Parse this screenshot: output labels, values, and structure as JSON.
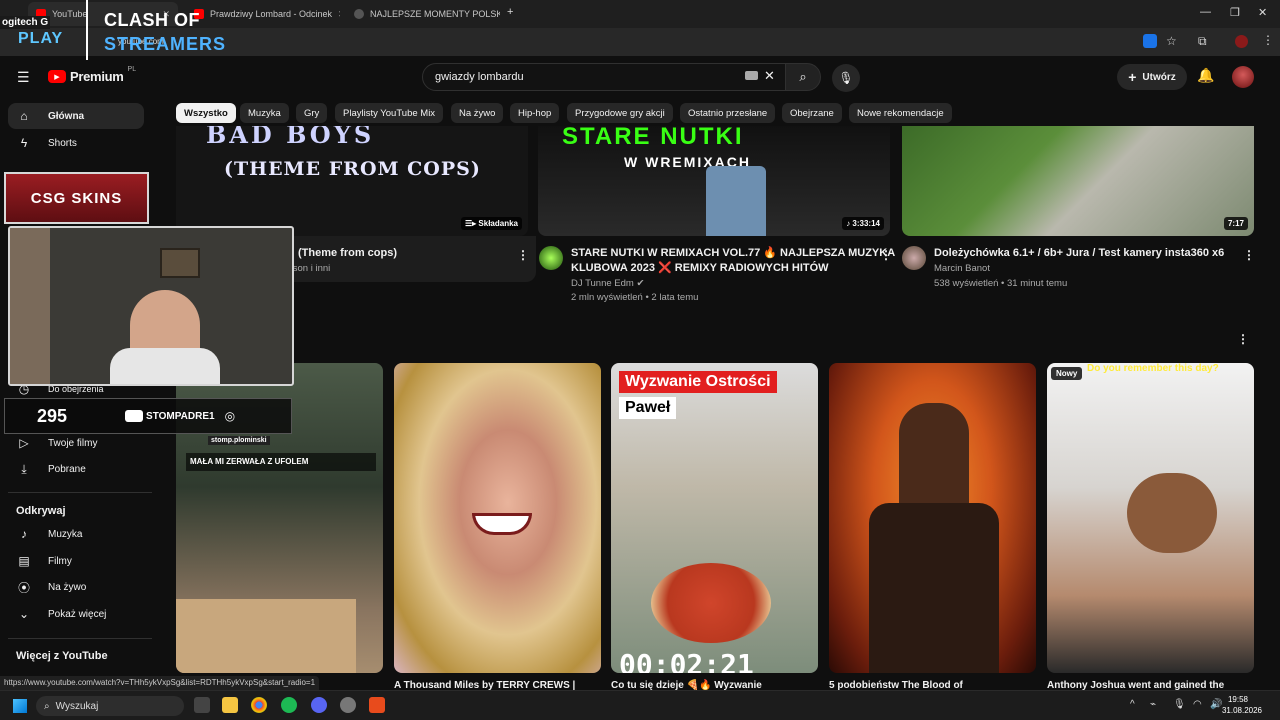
{
  "browser": {
    "tabs": [
      {
        "label": "YouTube"
      },
      {
        "label": "Prawdziwy Lombard - Odcinek"
      },
      {
        "label": "NAJLEPSZE MOMENTY POLSKIE"
      }
    ],
    "new_tab": "+",
    "url": "youtube.com"
  },
  "overlay": {
    "brand_top": "CLASH OF",
    "brand_bottom": "STREAMERS",
    "sponsor_left": "ogitech G",
    "sponsor_play": "PLAY",
    "csgo": "CSG SKINS",
    "counter": "295",
    "yt_handle": "STOMPADRE1",
    "ig_handle": "stomp.plominski",
    "caption": "MAŁA MI ZERWAŁA Z UFOLEM"
  },
  "youtube": {
    "logo": "Premium",
    "region": "PL",
    "search_value": "gwiazdy lombardu",
    "create_label": "Utwórz",
    "chips": [
      "Wszystko",
      "Muzyka",
      "Gry",
      "Playlisty YouTube Mix",
      "Na żywo",
      "Hip-hop",
      "Przygodowe gry akcji",
      "Ostatnio przesłane",
      "Obejrzane",
      "Nowe rekomendacje"
    ]
  },
  "sidebar": {
    "top": [
      {
        "label": "Główna",
        "icon": "home-icon"
      },
      {
        "label": "Shorts",
        "icon": "shorts-icon"
      }
    ],
    "you": [
      {
        "label": "Do obejrzenia",
        "icon": "clock-icon"
      },
      {
        "label": "Twoje filmy",
        "icon": "play-box-icon"
      },
      {
        "label": "Pobrane",
        "icon": "download-icon"
      }
    ],
    "explore_title": "Odkrywaj",
    "explore": [
      {
        "label": "Muzyka",
        "icon": "music-icon"
      },
      {
        "label": "Filmy",
        "icon": "film-icon"
      },
      {
        "label": "Na żywo",
        "icon": "live-icon"
      },
      {
        "label": "Pokaż więcej",
        "icon": "chevron-down-icon"
      }
    ],
    "more_title": "Więcej z YouTube"
  },
  "videos_top": [
    {
      "title_line1": "(Theme from cops)",
      "meta1": "kson i inni",
      "badge": "Składanka",
      "thumb_text_top": "BAD BOYS",
      "thumb_text": "(THEME FROM COPS)"
    },
    {
      "title_line1": "STARE NUTKI W REMIXACH VOL.77 🔥 NAJLEPSZA MUZYKA",
      "title_line2": "KLUBOWA 2023 ❌ REMIXY RADIOWYCH HITÓW",
      "channel": "DJ Tunne Edm",
      "stats": "2 mln wyświetleń • 2 lata temu",
      "duration": "3:33:14",
      "thumb_text": "STARE NUTKI",
      "thumb_sub": "W WREMIXACH"
    },
    {
      "title_line1": "Doleżychówka 6.1+ / 6b+ Jura / Test kamery insta360 x6",
      "channel": "Marcin Banot",
      "stats": "538 wyświetleń • 31 minut temu",
      "duration": "7:17"
    }
  ],
  "shorts": [
    {
      "title": ""
    },
    {
      "title": "A Thousand Miles by TERRY CREWS |"
    },
    {
      "title": "Co tu się dzieje 🍕🔥 Wyzwanie",
      "banner1": "Wyzwanie Ostrości",
      "banner2": "Paweł",
      "timer": "00:02:21"
    },
    {
      "title": "5 podobieństw The Blood of"
    },
    {
      "title": "Anthony Joshua went and gained the",
      "badge": "Nowy",
      "top_text": "Do you remember this day?"
    }
  ],
  "status_url": "https://www.youtube.com/watch?v=THh5ykVxpSg&list=RDTHh5ykVxpSg&start_radio=1",
  "taskbar": {
    "search": "Wyszukaj",
    "time": "19:58",
    "date": "31.08.2026"
  }
}
